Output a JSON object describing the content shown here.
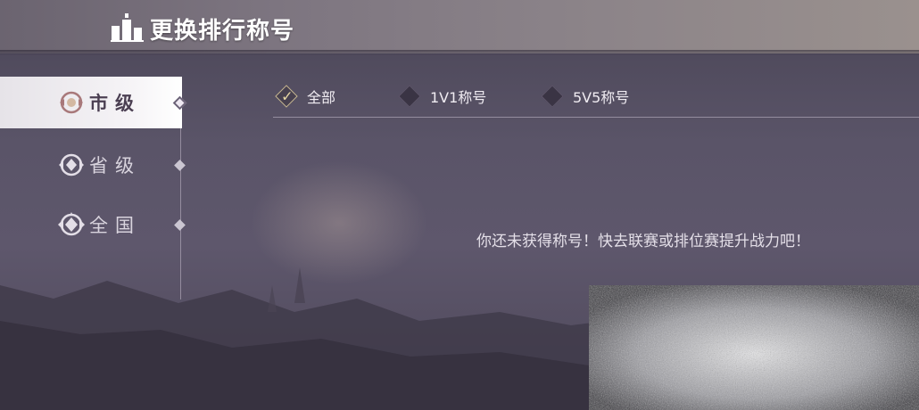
{
  "header": {
    "title": "更换排行称号",
    "icon": "ranking-bars-icon"
  },
  "sidebar": {
    "items": [
      {
        "label": "市级",
        "icon": "city-emblem-icon",
        "active": true
      },
      {
        "label": "省级",
        "icon": "province-emblem-icon",
        "active": false
      },
      {
        "label": "全国",
        "icon": "nation-emblem-icon",
        "active": false
      }
    ]
  },
  "filters": {
    "tabs": [
      {
        "label": "全部",
        "checked": true
      },
      {
        "label": "1V1称号",
        "checked": false
      },
      {
        "label": "5V5称号",
        "checked": false
      }
    ]
  },
  "main": {
    "empty_message": "你还未获得称号！快去联赛或排位赛提升战力吧！"
  },
  "colors": {
    "accent_gold": "#e9d9a5",
    "active_item_bg": "#f5f3f6",
    "text_light": "#e4dfe8"
  }
}
